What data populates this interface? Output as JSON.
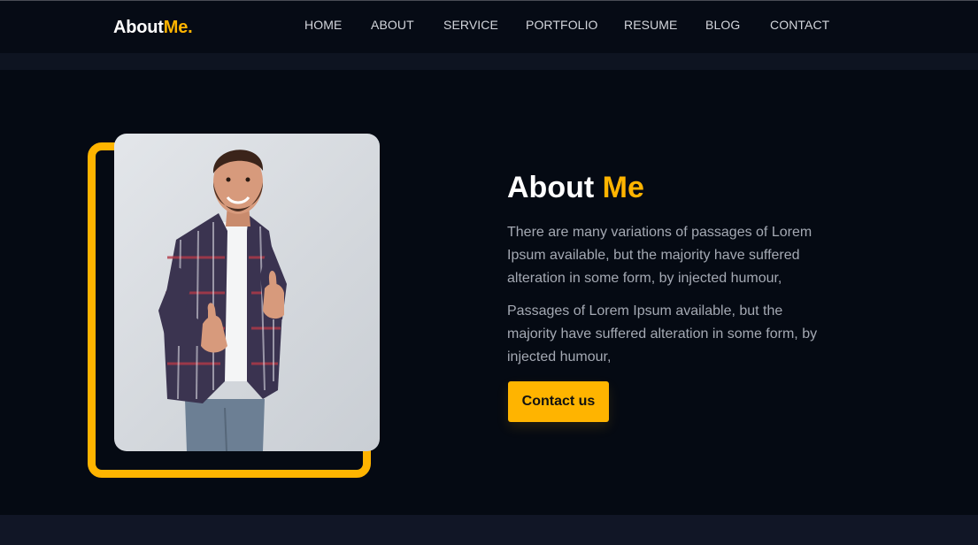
{
  "header": {
    "logo_main": "About",
    "logo_accent": "Me.",
    "nav": [
      "HOME",
      "ABOUT",
      "SERVICE",
      "PORTFOLIO",
      "RESUME",
      "BLOG",
      "CONTACT"
    ]
  },
  "about": {
    "title_main": "About",
    "title_accent": "Me",
    "paragraph1": "There are many variations of passages of Lorem Ipsum available, but the majority have suffered alteration in some form, by injected humour,",
    "paragraph2": "Passages of Lorem Ipsum available, but the majority have suffered alteration in some form, by injected humour,",
    "cta_label": "Contact us",
    "photo_alt": "Smiling man in plaid shirt giving thumbs up"
  },
  "colors": {
    "accent": "#ffb400",
    "background": "#050a13",
    "band": "#0e1421",
    "text_muted": "#a4a9b3"
  }
}
